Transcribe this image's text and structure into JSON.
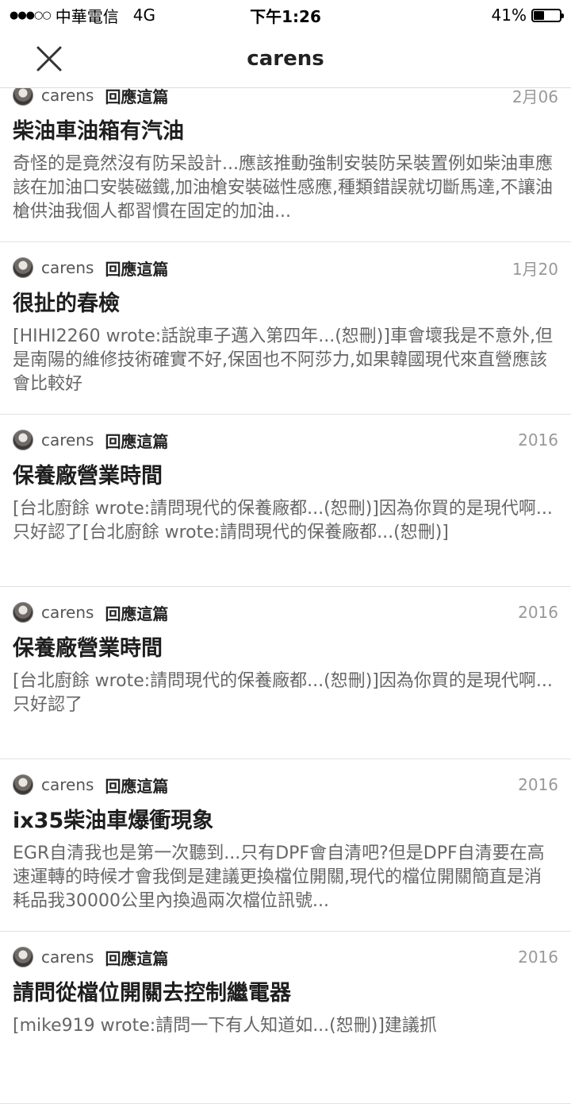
{
  "status": {
    "carrier": "中華電信",
    "network": "4G",
    "time": "下午1:26",
    "battery_text": "41%",
    "battery_level": 0.41
  },
  "nav": {
    "title": "carens"
  },
  "posts": [
    {
      "author": "carens",
      "action": "回應這篇",
      "date": "2月06",
      "title": "柴油車油箱有汽油",
      "body": "奇怪的是竟然沒有防呆設計...應該推動強制安裝防呆裝置例如柴油車應該在加油口安裝磁鐵,加油槍安裝磁性感應,種類錯誤就切斷馬達,不讓油槍供油我個人都習慣在固定的加油..."
    },
    {
      "author": "carens",
      "action": "回應這篇",
      "date": "1月20",
      "title": "很扯的春檢",
      "body": "[HIHI2260 wrote:話說車子邁入第四年...(恕刪)]車會壞我是不意外,但是南陽的維修技術確實不好,保固也不阿莎力,如果韓國現代來直營應該會比較好"
    },
    {
      "author": "carens",
      "action": "回應這篇",
      "date": "2016",
      "title": "保養廠營業時間",
      "body": "[台北廚餘 wrote:請問現代的保養廠都...(恕刪)]因為你買的是現代啊...只好認了[台北廚餘 wrote:請問現代的保養廠都...(恕刪)]"
    },
    {
      "author": "carens",
      "action": "回應這篇",
      "date": "2016",
      "title": "保養廠營業時間",
      "body": "[台北廚餘 wrote:請問現代的保養廠都...(恕刪)]因為你買的是現代啊...只好認了"
    },
    {
      "author": "carens",
      "action": "回應這篇",
      "date": "2016",
      "title": "ix35柴油車爆衝現象",
      "body": "EGR自清我也是第一次聽到...只有DPF會自清吧?但是DPF自清要在高速運轉的時候才會我倒是建議更換檔位開關,現代的檔位開關簡直是消耗品我30000公里內換過兩次檔位訊號..."
    },
    {
      "author": "carens",
      "action": "回應這篇",
      "date": "2016",
      "title": "請問從檔位開關去控制繼電器",
      "body": "[mike919 wrote:請問一下有人知道如...(恕刪)]建議抓"
    }
  ]
}
